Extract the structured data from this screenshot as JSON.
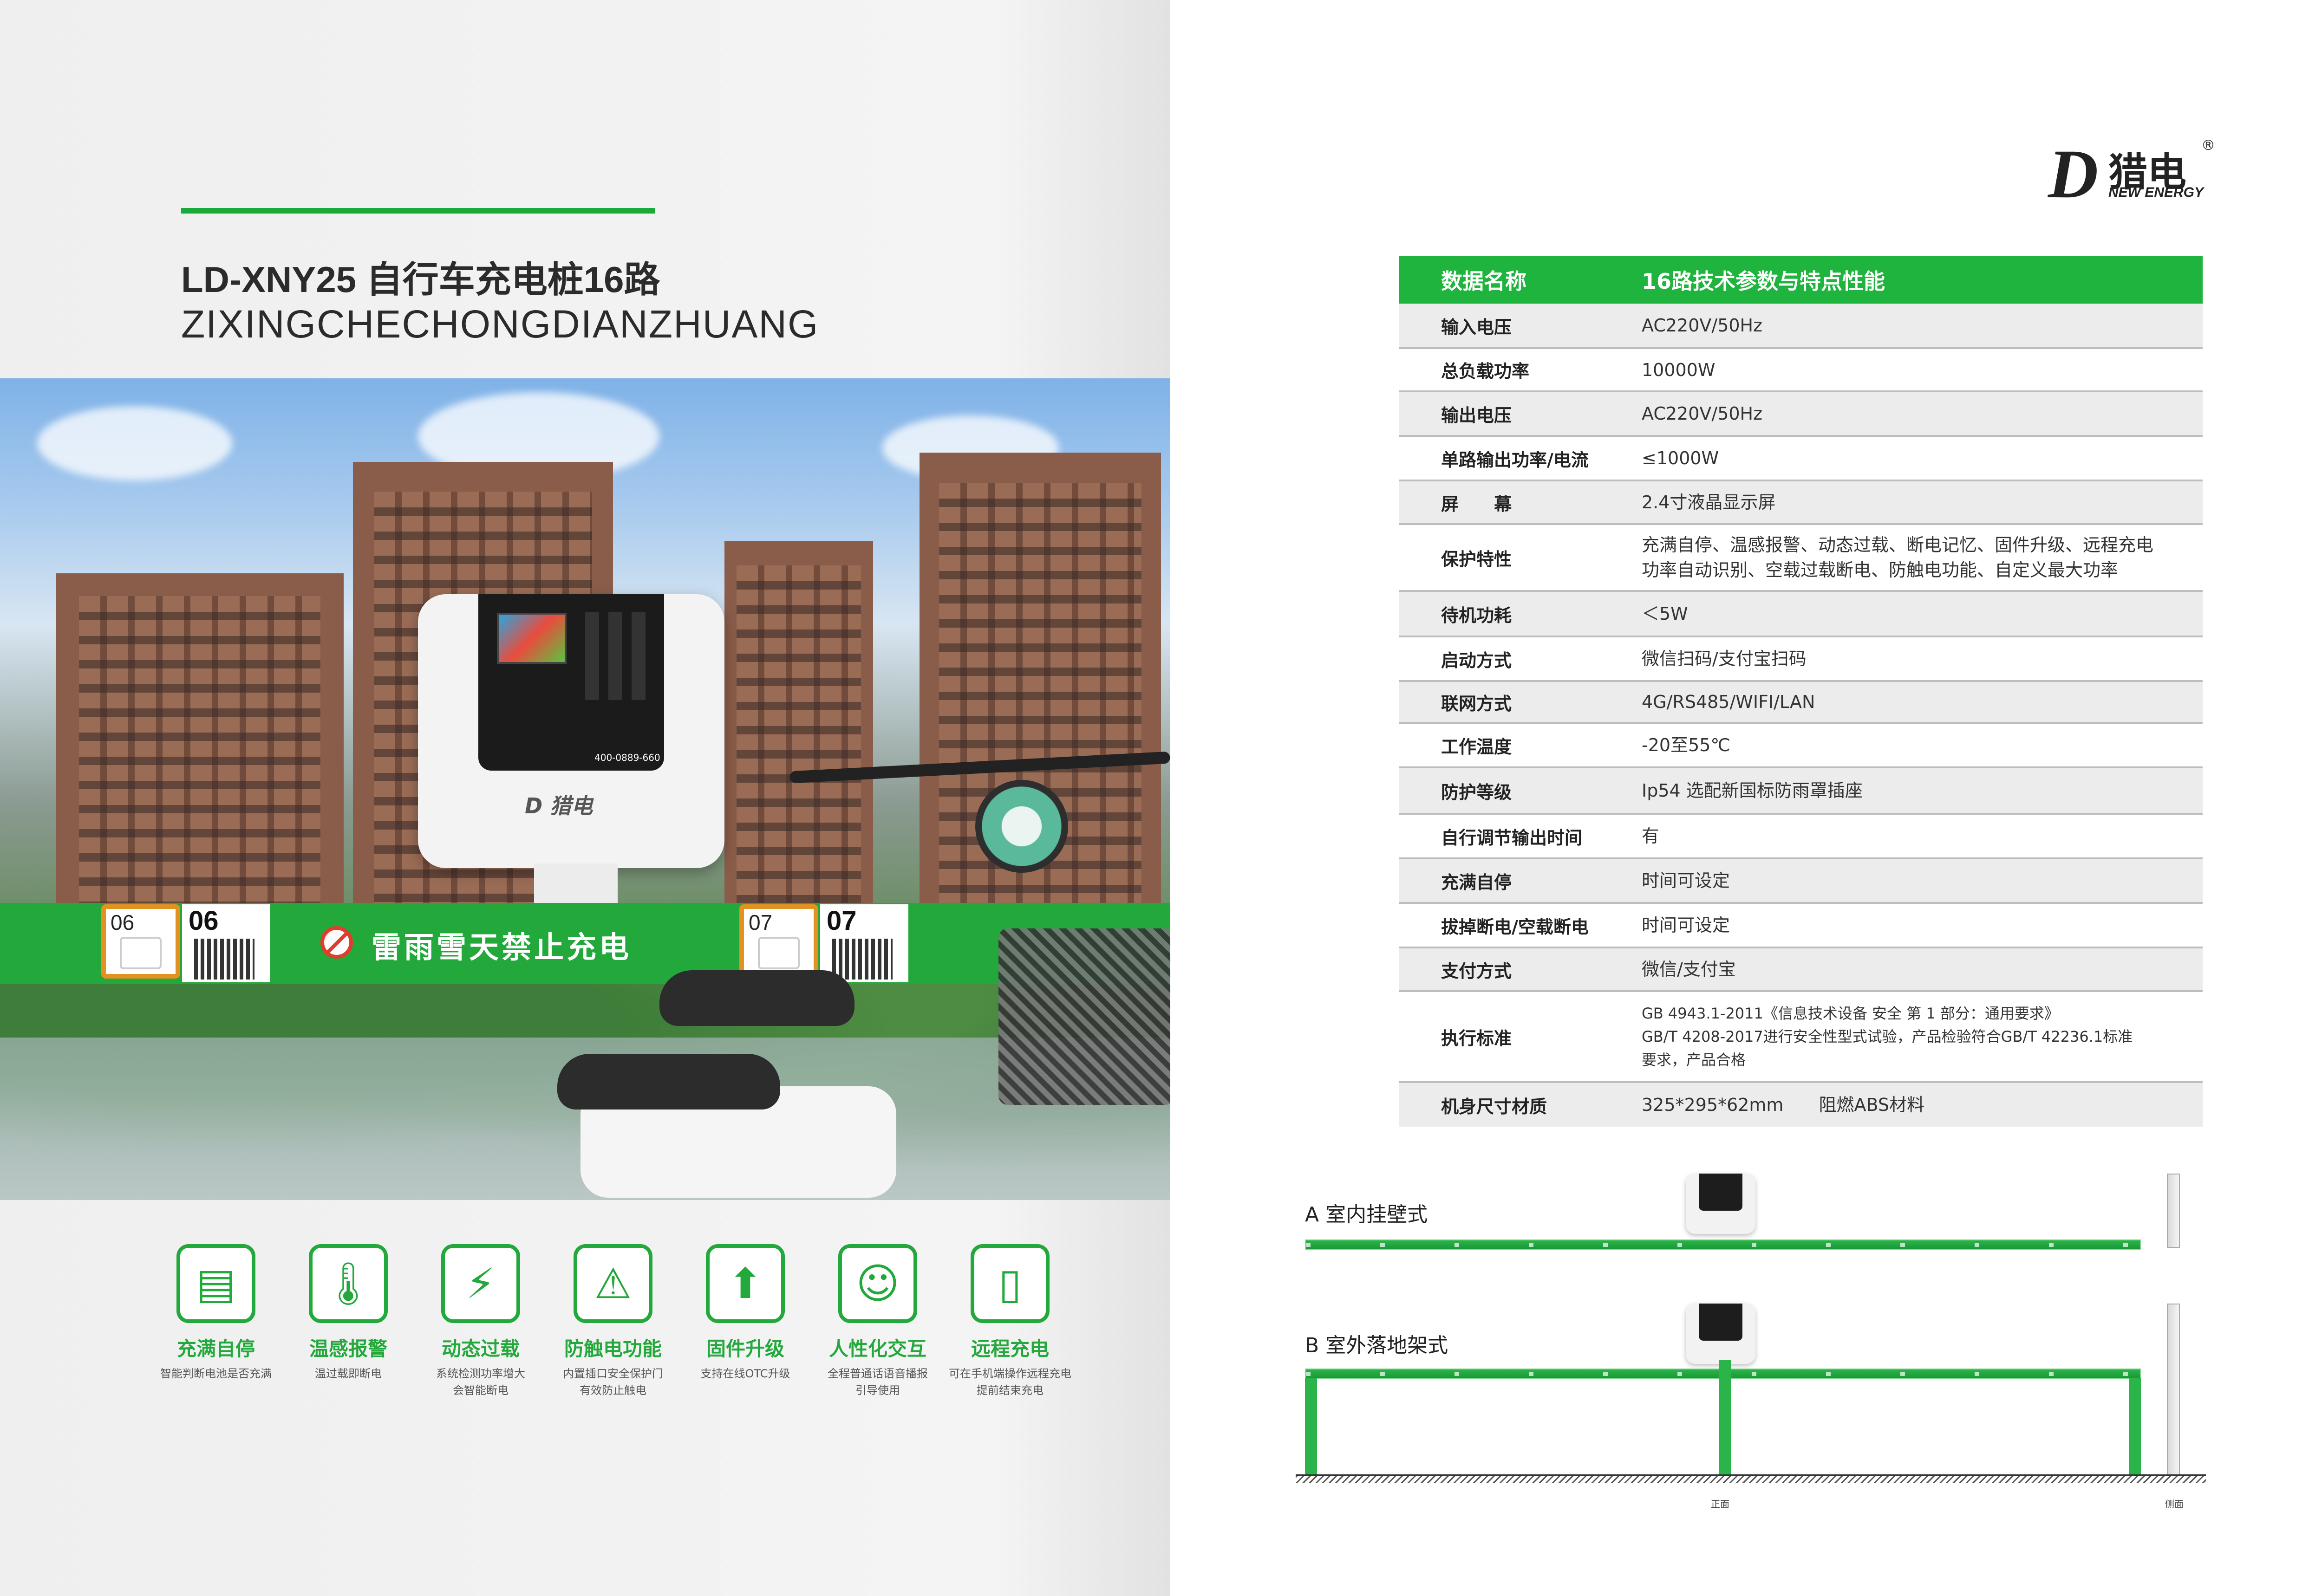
{
  "left": {
    "title": "LD-XNY25 自行车充电桩16路",
    "subtitle": "ZIXINGCHECHONGDIANZHUANG",
    "sockets": [
      {
        "socket_num": "06",
        "qr_num": "06"
      },
      {
        "socket_num": "07",
        "qr_num": "07"
      }
    ],
    "warning": "雷雨雪天禁止充电",
    "charger_phone": "400-0889-660",
    "features": [
      {
        "icon": "battery-icon",
        "glyph": "▤",
        "title": "充满自停",
        "desc": "智能判断电池是否充满"
      },
      {
        "icon": "thermometer-icon",
        "glyph": "🌡",
        "title": "温感报警",
        "desc": "温过载即断电"
      },
      {
        "icon": "lock-icon",
        "glyph": "⚡",
        "title": "动态过载",
        "desc": "系统检测功率增大\n会智能断电"
      },
      {
        "icon": "shield-icon",
        "glyph": "⚠",
        "title": "防触电功能",
        "desc": "内置插口安全保护门\n有效防止触电"
      },
      {
        "icon": "upgrade-icon",
        "glyph": "⬆",
        "title": "固件升级",
        "desc": "支持在线OTC升级"
      },
      {
        "icon": "head-icon",
        "glyph": "☺",
        "title": "人性化交互",
        "desc": "全程普通话语音播报\n引导使用"
      },
      {
        "icon": "phone-icon",
        "glyph": "▯",
        "title": "远程充电",
        "desc": "可在手机端操作远程充电\n提前结束充电"
      }
    ]
  },
  "right": {
    "logo_cn": "猎电",
    "logo_en": "NEW ENERGY",
    "logo_reg": "®",
    "table_header": {
      "name": "数据名称",
      "value": "16路技术参数与特点性能"
    },
    "rows": [
      {
        "name": "输入电压",
        "value": "AC220V/50Hz"
      },
      {
        "name": "总负载功率",
        "value": "10000W"
      },
      {
        "name": "输出电压",
        "value": "AC220V/50Hz"
      },
      {
        "name": "单路输出功率/电流",
        "value": "≤1000W"
      },
      {
        "name": "屏　　幕",
        "value": "2.4寸液晶显示屏"
      },
      {
        "name": "保护特性",
        "value": "充满自停、温感报警、动态过载、断电记忆、固件升级、远程充电\n功率自动识别、空载过载断电、防触电功能、自定义最大功率"
      },
      {
        "name": "待机功耗",
        "value": "＜5W"
      },
      {
        "name": "启动方式",
        "value": "微信扫码/支付宝扫码"
      },
      {
        "name": "联网方式",
        "value": "4G/RS485/WIFI/LAN"
      },
      {
        "name": "工作温度",
        "value": "-20至55℃"
      },
      {
        "name": "防护等级",
        "value": "Ip54 选配新国标防雨罩插座"
      },
      {
        "name": "自行调节输出时间",
        "value": "有"
      },
      {
        "name": "充满自停",
        "value": "时间可设定"
      },
      {
        "name": "拔掉断电/空载断电",
        "value": "时间可设定"
      },
      {
        "name": "支付方式",
        "value": "微信/支付宝"
      },
      {
        "name": "执行标准",
        "value": "GB 4943.1-2011《信息技术设备 安全 第 1 部分：通用要求》\nGB/T 4208-2017进行安全性型式试验，产品检验符合GB/T 42236.1标准\n要求，产品合格"
      },
      {
        "name": "机身尺寸材质",
        "value": "325*295*62mm　　阻燃ABS材料"
      }
    ],
    "mount_a": "A 室内挂壁式",
    "mount_b": "B 室外落地架式",
    "front_view": "正面",
    "side_view": "侧面"
  }
}
